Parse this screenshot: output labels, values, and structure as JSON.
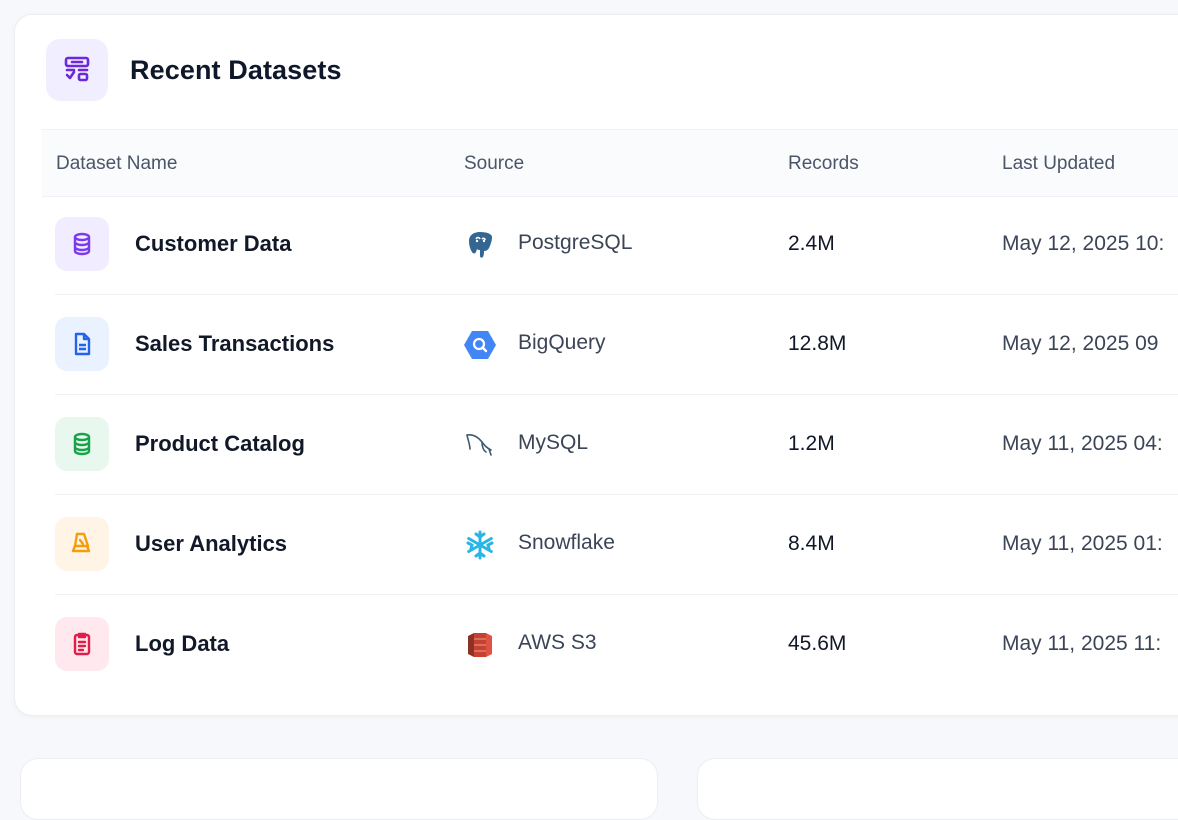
{
  "card": {
    "title": "Recent Datasets",
    "icon": "table-list-icon"
  },
  "table": {
    "columns": [
      "Dataset Name",
      "Source",
      "Records",
      "Last Updated"
    ],
    "rows": [
      {
        "name": "Customer Data",
        "icon": "database-icon",
        "icon_color": "#7c3aed",
        "icon_bg": "#f1ecff",
        "source": "PostgreSQL",
        "source_icon": "postgresql-icon",
        "records": "2.4M",
        "updated": "May 12, 2025 10:"
      },
      {
        "name": "Sales Transactions",
        "icon": "document-icon",
        "icon_color": "#2563eb",
        "icon_bg": "#eaf2ff",
        "source": "BigQuery",
        "source_icon": "bigquery-icon",
        "records": "12.8M",
        "updated": "May 12, 2025 09"
      },
      {
        "name": "Product Catalog",
        "icon": "database-icon",
        "icon_color": "#16a34a",
        "icon_bg": "#e8f8ee",
        "source": "MySQL",
        "source_icon": "mysql-icon",
        "records": "1.2M",
        "updated": "May 11, 2025 04:"
      },
      {
        "name": "User Analytics",
        "icon": "user-chart-icon",
        "icon_color": "#f59e0b",
        "icon_bg": "#fff4e6",
        "source": "Snowflake",
        "source_icon": "snowflake-icon",
        "records": "8.4M",
        "updated": "May 11, 2025 01:"
      },
      {
        "name": "Log Data",
        "icon": "log-file-icon",
        "icon_color": "#e11d48",
        "icon_bg": "#ffe9ee",
        "source": "AWS S3",
        "source_icon": "aws-s3-icon",
        "records": "45.6M",
        "updated": "May 11, 2025 11:"
      }
    ]
  },
  "colors": {
    "accent": "#6d28d9",
    "header_icon_bg": "#f1efff"
  }
}
